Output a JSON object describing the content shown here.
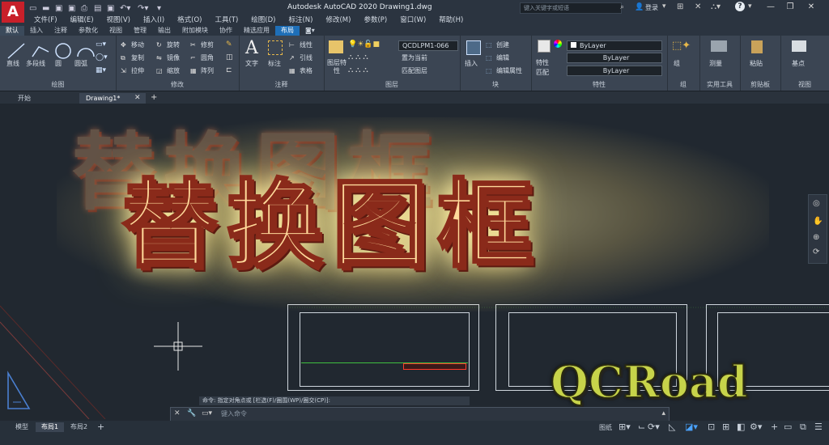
{
  "app": {
    "logo": "A",
    "window_title": "Autodesk AutoCAD 2020   Drawing1.dwg",
    "search_placeholder": "键入关键字或短语",
    "signin": "登录",
    "help": "?"
  },
  "menu": [
    "文件(F)",
    "编辑(E)",
    "视图(V)",
    "插入(I)",
    "格式(O)",
    "工具(T)",
    "绘图(D)",
    "标注(N)",
    "修改(M)",
    "参数(P)",
    "窗口(W)",
    "帮助(H)"
  ],
  "ribbon_tabs": [
    "默认",
    "插入",
    "注释",
    "参数化",
    "视图",
    "管理",
    "输出",
    "附加模块",
    "协作",
    "精选应用",
    "布局"
  ],
  "ribbon": {
    "draw": {
      "title": "绘图",
      "tools": [
        "直线",
        "多段线",
        "圆",
        "圆弧"
      ]
    },
    "modify": {
      "title": "修改",
      "tools": [
        "移动",
        "旋转",
        "修剪",
        "复制",
        "镜像",
        "圆角",
        "拉伸",
        "缩放",
        "阵列"
      ]
    },
    "annotation": {
      "title": "注释",
      "tools": [
        "文字",
        "标注",
        "线性",
        "引线",
        "表格"
      ]
    },
    "layers": {
      "title": "图层",
      "tools": [
        "图层特性",
        "置为当前",
        "匹配图层"
      ],
      "current_layer": "QCDLPM1-066"
    },
    "block": {
      "title": "块",
      "tools": [
        "插入",
        "创建",
        "编辑",
        "编辑属性"
      ]
    },
    "properties": {
      "title": "特性",
      "tools": [
        "特性",
        "匹配"
      ],
      "color": "ByLayer",
      "linetype": "ByLayer",
      "lineweight": "ByLayer"
    },
    "groups": {
      "title": "组",
      "tools": [
        "组"
      ]
    },
    "utilities": {
      "title": "实用工具",
      "tools": [
        "测量"
      ]
    },
    "clipboard": {
      "title": "剪贴板",
      "tools": [
        "粘贴"
      ]
    },
    "view": {
      "title": "视图",
      "tools": [
        "基点"
      ]
    }
  },
  "file_tabs": [
    "开始",
    "Drawing1*"
  ],
  "overlay": {
    "title": "替换图框",
    "brand": "QCRoad"
  },
  "command": {
    "history": "命令: 指定对角点或 [栏选(F)/圈围(WP)/圈交(CP)]:",
    "placeholder": "键入命令"
  },
  "layout_tabs": [
    "模型",
    "布局1",
    "布局2"
  ],
  "status": {
    "paper": "图纸"
  },
  "colors": {
    "accent": "#1e6fb8",
    "titleGlow": "#ffd99a",
    "titleStroke": "#8a2a1a",
    "brand": "#c7d34a"
  }
}
